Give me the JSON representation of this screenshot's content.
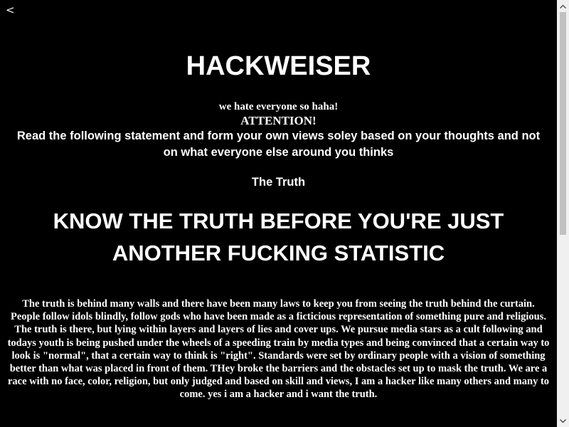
{
  "nav": {
    "back_label": "<"
  },
  "header": {
    "title": "HACKWEISER",
    "tagline": "we hate everyone so haha!"
  },
  "notice": {
    "attention": "ATTENTION!",
    "statement": "Read the following statement and form your own views soley based on your thoughts and not on what everyone else around you thinks"
  },
  "section": {
    "label": "The Truth",
    "headline": "KNOW THE TRUTH BEFORE YOU'RE JUST ANOTHER FUCKING STATISTIC",
    "body": "The truth is behind many walls and there have been many laws to keep you from seeing the truth behind the curtain. People follow idols blindly, follow gods who have been made as a ficticious representation of something pure and religious. The truth is there, but lying within layers and layers of lies and cover ups. We pursue media stars as a cult following and todays youth is being pushed under the wheels of a speeding train by media types and being convinced that a certain way to look is \"normal\", that a certain way to think is \"right\". Standards were set by ordinary people with a vision of something better than what was placed in front of them. THey broke the barriers and the obstacles set up to mask the truth. We are a race with no face, color, religion, but only judged and based on skill and views, I am a hacker like many others and many to come. yes i am a hacker and i want the truth."
  },
  "scrollbar": {
    "up_icon": "chevron-up-icon",
    "down_icon": "chevron-down-icon",
    "position_fraction": 0
  },
  "colors": {
    "background": "#000000",
    "text": "#ffffff",
    "scrollbar_track": "#f0f0f0",
    "scrollbar_thumb": "#c1c1c1",
    "scrollbar_arrow": "#505050"
  }
}
